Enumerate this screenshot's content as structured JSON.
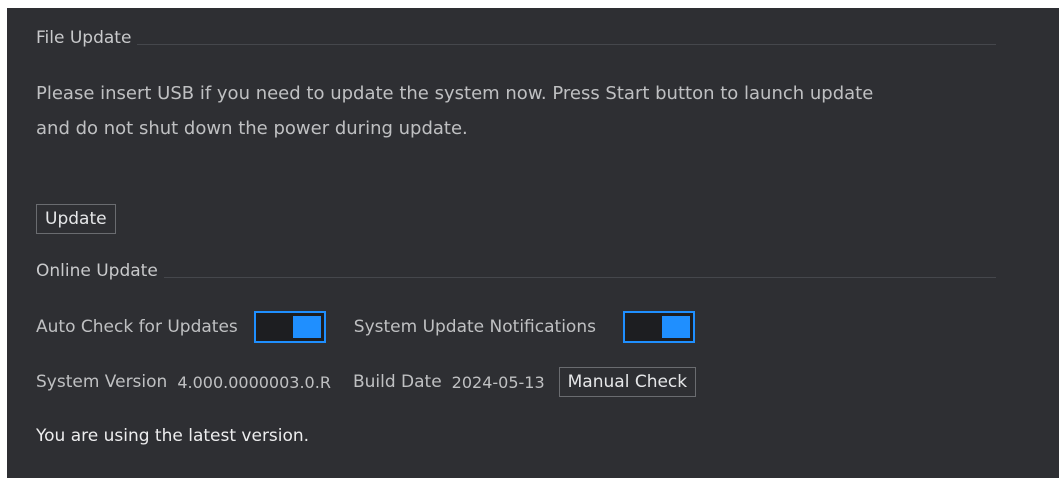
{
  "file_update": {
    "title": "File Update",
    "description_line1": "Please insert USB if you need to update the system now. Press Start button to launch update",
    "description_line2": "and do not shut down the power during update.",
    "update_button": "Update"
  },
  "online_update": {
    "title": "Online Update",
    "auto_check_label": "Auto Check for Updates",
    "auto_check_enabled": true,
    "notifications_label": "System Update Notifications",
    "notifications_enabled": true,
    "system_version_label": "System Version",
    "system_version_value": "4.000.0000003.0.R",
    "build_date_label": "Build Date",
    "build_date_value": "2024-05-13",
    "manual_check_button": "Manual Check",
    "status_message": "You are using the latest version."
  },
  "colors": {
    "background": "#2e2f33",
    "accent": "#1f8fff",
    "text": "#bfc0c2"
  }
}
